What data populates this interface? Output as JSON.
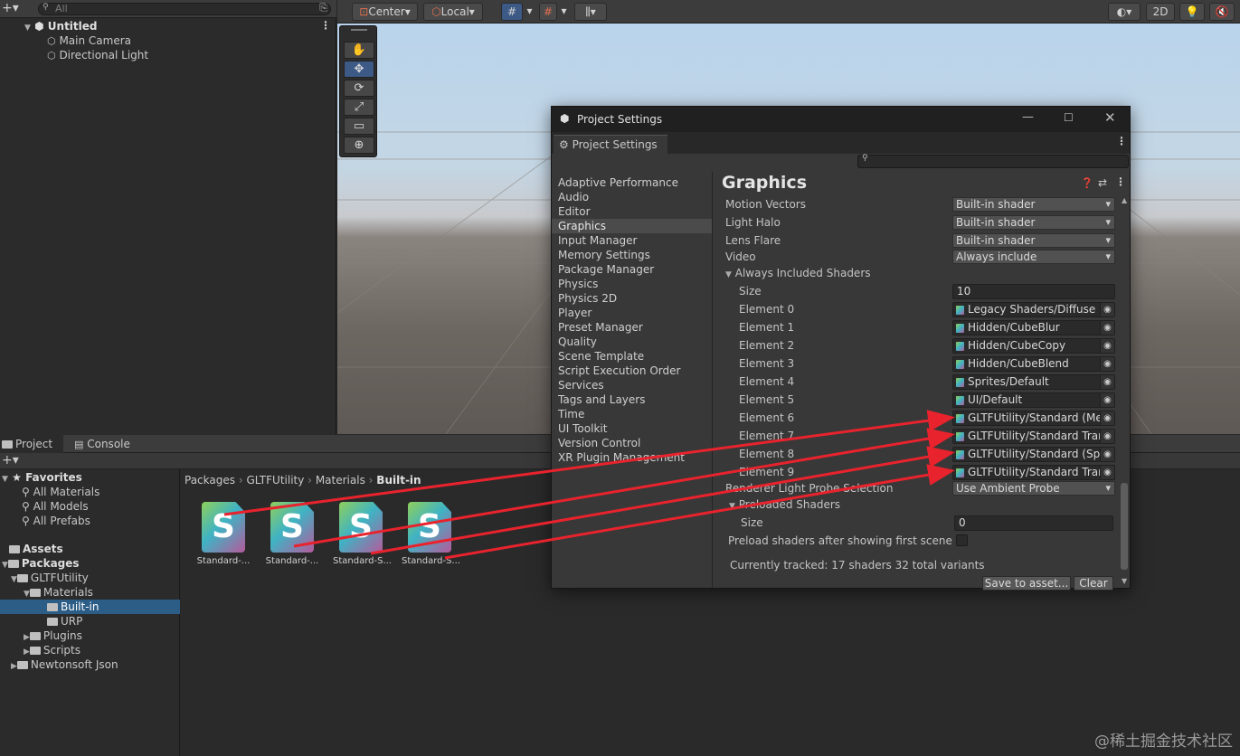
{
  "hierarchy": {
    "search_placeholder": "All",
    "scene": "Untitled",
    "objects": [
      "Main Camera",
      "Directional Light"
    ]
  },
  "scene_toolbar": {
    "pivot_label": "Center",
    "space_label": "Local",
    "mode_2d": "2D"
  },
  "project_panel": {
    "tabs": [
      "Project",
      "Console"
    ],
    "favorites_label": "Favorites",
    "favorites": [
      "All Materials",
      "All Models",
      "All Prefabs"
    ],
    "assets_label": "Assets",
    "packages_label": "Packages",
    "tree": [
      "GLTFUtility",
      "Materials",
      "Built-in",
      "URP",
      "Plugins",
      "Scripts",
      "Newtonsoft Json"
    ],
    "breadcrumb": [
      "Packages",
      "GLTFUtility",
      "Materials",
      "Built-in"
    ],
    "assets": [
      "Standard-...",
      "Standard-...",
      "Standard-S...",
      "Standard-S..."
    ],
    "asset_glyph": "S"
  },
  "settings_window": {
    "title": "Project Settings",
    "tab": "Project Settings",
    "nav": [
      "Adaptive Performance",
      "Audio",
      "Editor",
      "Graphics",
      "Input Manager",
      "Memory Settings",
      "Package Manager",
      "Physics",
      "Physics 2D",
      "Player",
      "Preset Manager",
      "Quality",
      "Scene Template",
      "Script Execution Order",
      "Services",
      "Tags and Layers",
      "Time",
      "UI Toolkit",
      "Version Control",
      "XR Plugin Management"
    ],
    "selected_nav": "Graphics",
    "heading": "Graphics",
    "rows": [
      {
        "label": "Motion Vectors",
        "value": "Built-in shader"
      },
      {
        "label": "Light Halo",
        "value": "Built-in shader"
      },
      {
        "label": "Lens Flare",
        "value": "Built-in shader"
      },
      {
        "label": "Video",
        "value": "Always include"
      }
    ],
    "always_included_label": "Always Included Shaders",
    "size_label": "Size",
    "size_value": "10",
    "elements": [
      {
        "label": "Element 0",
        "value": "Legacy Shaders/Diffuse"
      },
      {
        "label": "Element 1",
        "value": "Hidden/CubeBlur"
      },
      {
        "label": "Element 2",
        "value": "Hidden/CubeCopy"
      },
      {
        "label": "Element 3",
        "value": "Hidden/CubeBlend"
      },
      {
        "label": "Element 4",
        "value": "Sprites/Default"
      },
      {
        "label": "Element 5",
        "value": "UI/Default"
      },
      {
        "label": "Element 6",
        "value": "GLTFUtility/Standard (Me"
      },
      {
        "label": "Element 7",
        "value": "GLTFUtility/Standard Tran"
      },
      {
        "label": "Element 8",
        "value": "GLTFUtility/Standard (Spe"
      },
      {
        "label": "Element 9",
        "value": "GLTFUtility/Standard Tran"
      }
    ],
    "renderer_probe_label": "Renderer Light Probe Selection",
    "renderer_probe_value": "Use Ambient Probe",
    "preloaded_label": "Preloaded Shaders",
    "preloaded_size_label": "Size",
    "preloaded_size_value": "0",
    "preload_after_label": "Preload shaders after showing first scene",
    "tracked_text": "Currently tracked: 17 shaders 32 total variants",
    "save_button": "Save to asset...",
    "clear_button": "Clear"
  },
  "accent_colors": {
    "selection": "#2c5d87",
    "arrow": "#e8232d"
  },
  "watermark": "@稀土掘金技术社区"
}
